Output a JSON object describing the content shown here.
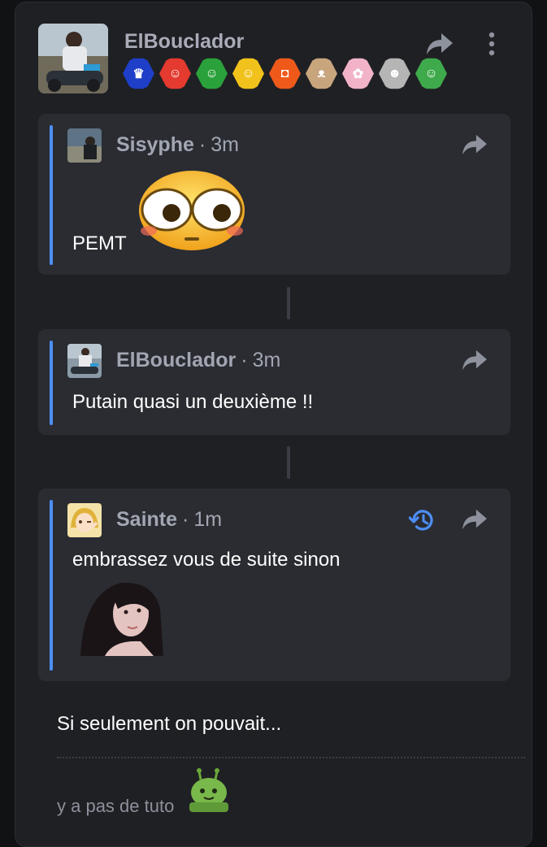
{
  "post": {
    "username": "ElBouclador",
    "badges": [
      {
        "icon": "crown-badge-icon",
        "color": "#1f3fc8"
      },
      {
        "icon": "clown-badge-icon",
        "color": "#e43a2f"
      },
      {
        "icon": "santa-smiley-badge-icon",
        "color": "#2aa13a"
      },
      {
        "icon": "smiley-badge-icon",
        "color": "#f1c21b"
      },
      {
        "icon": "orange-logo-badge-icon",
        "color": "#ef5a1b"
      },
      {
        "icon": "cat-badge-icon",
        "color": "#c9a57e"
      },
      {
        "icon": "anime-girl-badge-icon",
        "color": "#f2b3c9"
      },
      {
        "icon": "face-badge-icon",
        "color": "#b5b5b5"
      },
      {
        "icon": "cartoon-face-badge-icon",
        "color": "#3faa4c"
      }
    ],
    "text": "Si seulement on pouvait...",
    "signature": "y a pas de tuto"
  },
  "quotes": [
    {
      "author": "Sisyphe",
      "time": "3m",
      "text": "PEMT"
    },
    {
      "author": "ElBouclador",
      "time": "3m",
      "text": "Putain quasi un deuxième !!"
    },
    {
      "author": "Sainte",
      "time": "1m",
      "text": "embrassez vous de suite sinon"
    }
  ],
  "separator": "·",
  "colors": {
    "accent": "#4d8ef5",
    "background": "#1f2024",
    "quote_bg": "#2a2c32"
  }
}
